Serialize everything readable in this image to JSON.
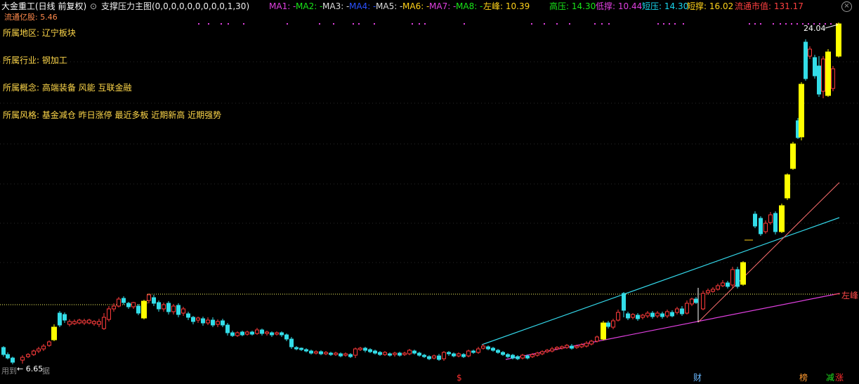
{
  "header": {
    "stock_title": "大金重工(日线 前复权)",
    "indicator_icon": "dropdown-circle-icon",
    "indicator_name": "支撑压力主图(0,0,0,0,0,0,0,0,0,1,30)",
    "ma_items": [
      {
        "label": "MA1: -",
        "color": "#e040e0"
      },
      {
        "label": "MA2: -",
        "color": "#19e619"
      },
      {
        "label": "MA3: -",
        "color": "#dddddd"
      },
      {
        "label": "MA4: -",
        "color": "#2a50ff"
      },
      {
        "label": "MA5: -",
        "color": "#dddddd"
      },
      {
        "label": "MA6: -",
        "color": "#ffd21a"
      },
      {
        "label": "MA7: -",
        "color": "#e040e0"
      },
      {
        "label": "MA8: -",
        "color": "#19e619"
      }
    ],
    "zuofeng": {
      "label": "左峰: 10.39",
      "color": "#ffd21a"
    },
    "metrics": [
      {
        "label": "高压: 14.30",
        "color": "#19e619"
      },
      {
        "label": "低撑: 10.44",
        "color": "#e040e0"
      },
      {
        "label": "短压: 14.30",
        "color": "#19d8f0"
      },
      {
        "label": "短撑: 16.02",
        "color": "#ffd21a"
      },
      {
        "label": "流通市值: 131.17",
        "color": "#ff4040"
      }
    ]
  },
  "line2": "流通亿股: 5.46",
  "info_lines": [
    "所属地区: 辽宁板块",
    "所属行业: 钢加工",
    "所属概念: 高端装备 风能 互联金融",
    "所属风格: 基金减仓 昨日涨停 最近多板 近期新高 近期强势"
  ],
  "peak_label": "24.04",
  "low_label": "← 6.65",
  "bottom_text": "用到",
  "bottom_text2": "据",
  "right_label": "左峰",
  "markers": [
    {
      "text": "$",
      "color": "#ff3030"
    },
    {
      "text": "财",
      "color": "#6ab8ff"
    },
    {
      "text": "榜",
      "color": "#ff9a30"
    },
    {
      "text": "减",
      "color": "#20e020"
    },
    {
      "text": "涨",
      "color": "#ff3030"
    }
  ],
  "colors": {
    "up": "#ff3b3b",
    "down": "#33dde8",
    "limit_up": "#ffff00",
    "support_line": "#e040e0",
    "trend_line": "#33d6e8",
    "steep_line": "#ff7070",
    "zuofeng_line": "#ffff66"
  }
}
